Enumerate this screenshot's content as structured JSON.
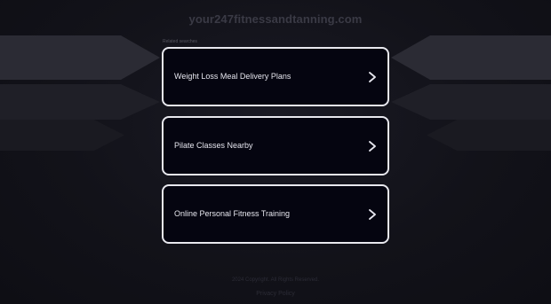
{
  "header": {
    "domain": "your247fitnessandtanning.com"
  },
  "searches": {
    "section_label": "Related searches",
    "items": [
      {
        "label": "Weight Loss Meal Delivery Plans"
      },
      {
        "label": "Pilate Classes Nearby"
      },
      {
        "label": "Online Personal Fitness Training"
      }
    ]
  },
  "footer": {
    "copyright": "2024 Copyright. All Rights Reserved.",
    "privacy_label": "Privacy Policy"
  },
  "icons": {
    "item_arrow": "chevron-right-icon"
  },
  "colors": {
    "background": "#101018",
    "card_background": "#050510",
    "card_border": "#e8e8ee",
    "card_text": "#e6e6ee",
    "title_text": "#3a3a45"
  }
}
